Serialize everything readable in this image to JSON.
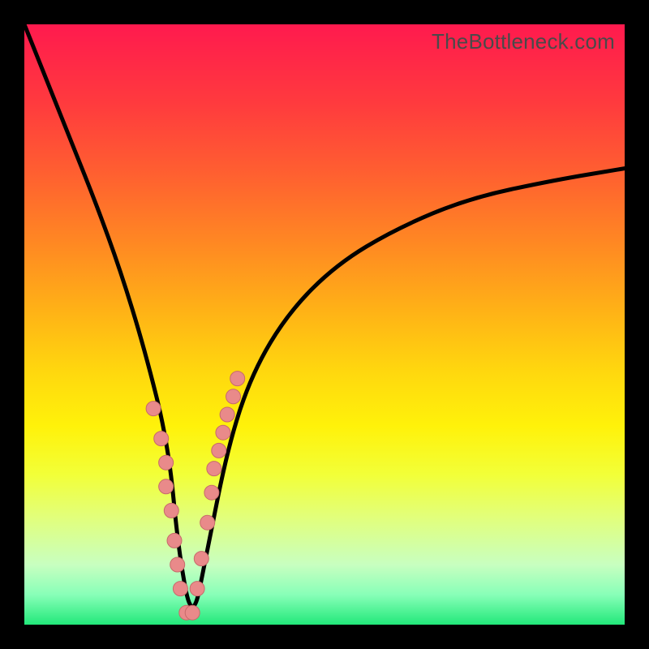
{
  "watermark": "TheBottleneck.com",
  "chart_data": {
    "type": "line",
    "title": "",
    "xlabel": "",
    "ylabel": "",
    "xlim": [
      0,
      100
    ],
    "ylim": [
      0,
      100
    ],
    "series": [
      {
        "name": "bottleneck-curve",
        "x": [
          0,
          4,
          8,
          12,
          16,
          20,
          24,
          25.7,
          28,
          30.4,
          34,
          38,
          44,
          52,
          62,
          74,
          88,
          100
        ],
        "y": [
          100,
          90,
          80,
          70,
          59,
          46,
          30,
          12,
          0,
          12,
          30,
          42,
          52,
          60,
          66,
          71,
          74,
          76
        ]
      },
      {
        "name": "data-points",
        "x": [
          21.5,
          22.8,
          23.6,
          23.6,
          24.5,
          25.0,
          25.5,
          26.0,
          27.0,
          28.0,
          28.8,
          29.5,
          30.5,
          31.2,
          31.6,
          32.4,
          33.1,
          33.8,
          34.8,
          35.5
        ],
        "y": [
          36,
          31,
          27,
          23,
          19,
          14,
          10,
          6,
          2,
          2,
          6,
          11,
          17,
          22,
          26,
          29,
          32,
          35,
          38,
          41
        ]
      }
    ],
    "colors": {
      "curve": "#000000",
      "points_fill": "#e98a8a",
      "points_stroke": "#c76a6a"
    }
  }
}
